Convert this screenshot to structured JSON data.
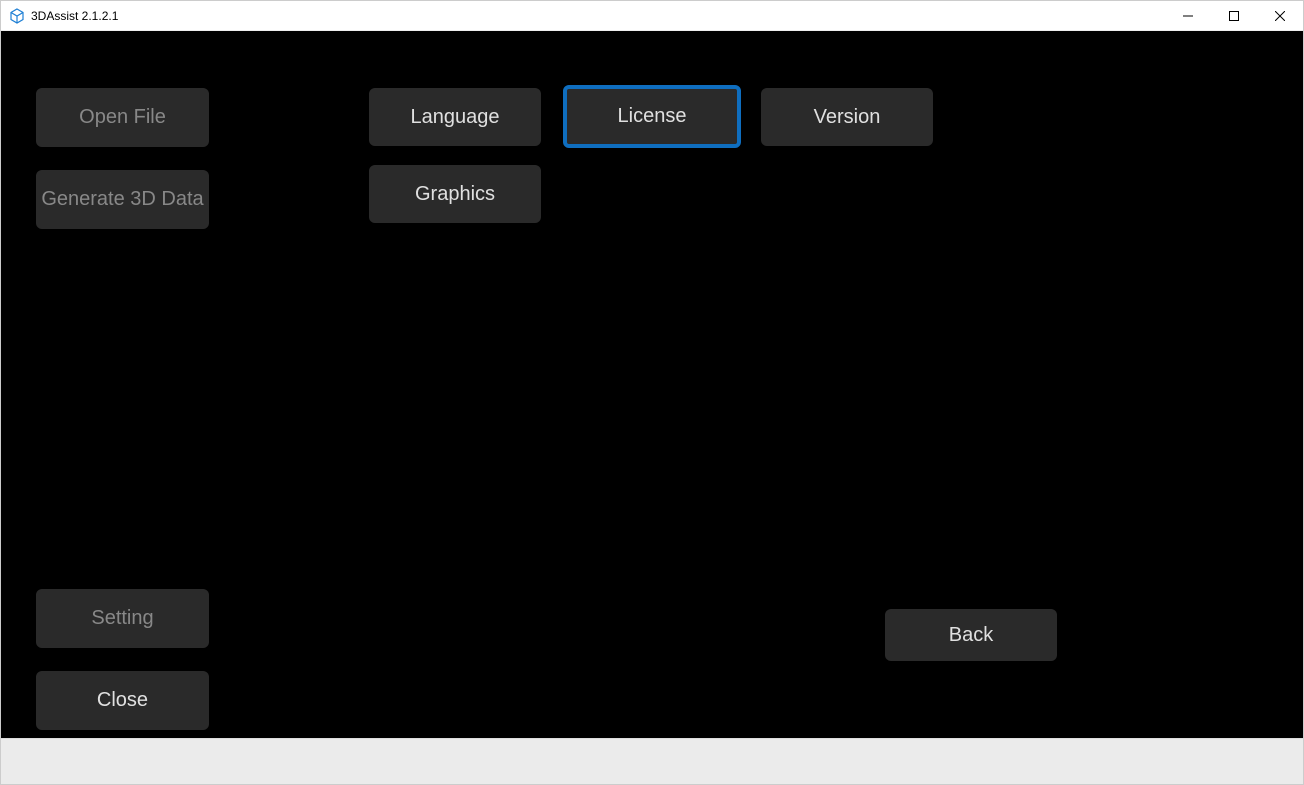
{
  "titlebar": {
    "app_title": "3DAssist 2.1.2.1"
  },
  "sidebar": {
    "open_file": "Open File",
    "generate_3d": "Generate 3D Data",
    "setting": "Setting",
    "close": "Close"
  },
  "main": {
    "language": "Language",
    "license": "License",
    "version": "Version",
    "graphics": "Graphics",
    "back": "Back"
  },
  "colors": {
    "accent": "#0f6ebf",
    "button_bg": "#2a2a2a"
  }
}
